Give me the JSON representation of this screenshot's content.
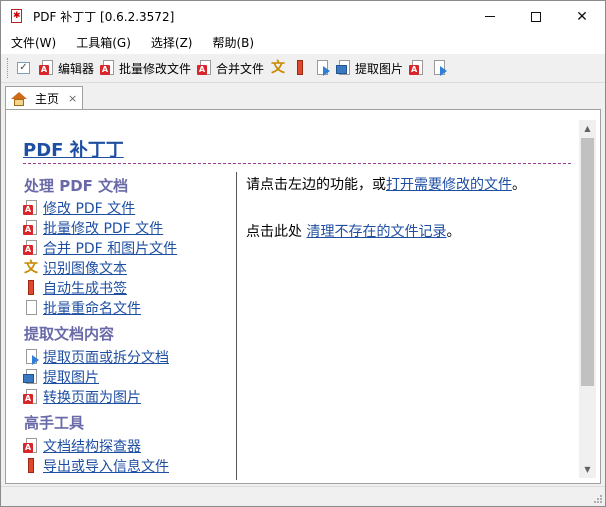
{
  "window": {
    "title": "PDF 补丁丁 [0.6.2.3572]",
    "controls": {
      "minimize": "–",
      "maximize": "□",
      "close": "✕"
    }
  },
  "menu": [
    {
      "label": "文件(W)"
    },
    {
      "label": "工具箱(G)"
    },
    {
      "label": "选择(Z)"
    },
    {
      "label": "帮助(B)"
    }
  ],
  "toolbar": {
    "editor_label": "编辑器",
    "batch_modify_label": "批量修改文件",
    "merge_label": "合并文件",
    "extract_images_label": "提取图片"
  },
  "tabs": [
    {
      "label": "主页",
      "close": "×"
    }
  ],
  "home": {
    "title": "PDF 补丁丁",
    "sections": [
      {
        "heading": "处理 PDF 文档",
        "links": [
          {
            "label": "修改 PDF 文件",
            "icon": "pdf-page-icon"
          },
          {
            "label": "批量修改 PDF 文件",
            "icon": "pdf-batch-icon"
          },
          {
            "label": "合并 PDF 和图片文件",
            "icon": "merge-icon"
          },
          {
            "label": "识别图像文本",
            "icon": "ocr-icon"
          },
          {
            "label": "自动生成书签",
            "icon": "bookmark-icon"
          },
          {
            "label": "批量重命名文件",
            "icon": "rename-icon"
          }
        ]
      },
      {
        "heading": "提取文档内容",
        "links": [
          {
            "label": "提取页面或拆分文档",
            "icon": "extract-pages-icon"
          },
          {
            "label": "提取图片",
            "icon": "extract-images-icon"
          },
          {
            "label": "转换页面为图片",
            "icon": "render-pages-icon"
          }
        ]
      },
      {
        "heading": "高手工具",
        "links": [
          {
            "label": "文档结构探查器",
            "icon": "inspector-icon"
          },
          {
            "label": "导出或导入信息文件",
            "icon": "export-info-icon"
          }
        ]
      }
    ],
    "right": {
      "line1_prefix": "请点击左边的功能，或",
      "line1_link": "打开需要修改的文件",
      "line1_suffix": "。",
      "line2_prefix": "点击此处 ",
      "line2_link": "清理不存在的文件记录",
      "line2_suffix": "。"
    }
  }
}
